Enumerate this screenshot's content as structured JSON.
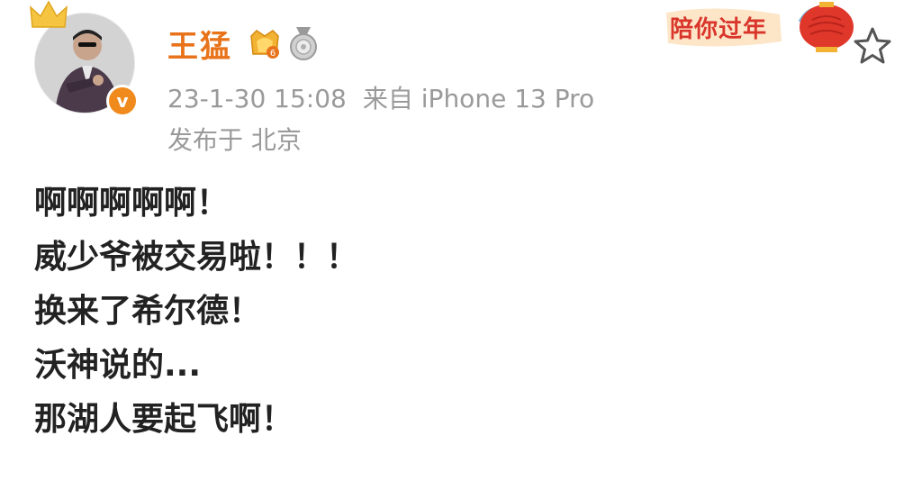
{
  "post": {
    "author": "王猛",
    "timestamp": "23-1-30 15:08",
    "source": "来自 iPhone 13 Pro",
    "location": "发布于 北京",
    "lines": [
      "啊啊啊啊啊！",
      "威少爷被交易啦！！！",
      "换来了希尔德！",
      "沃神说的...",
      "那湖人要起飞啊！"
    ]
  },
  "badges": {
    "verified_glyph": "v",
    "level_badge_icon": "gold-level-badge-icon",
    "medal_icon": "silver-medal-icon"
  },
  "decoration": {
    "newyear_label": "陪你过年"
  },
  "colors": {
    "username": "#e8731a",
    "meta": "#9a9a9a",
    "body_text": "#222222",
    "verified": "#f08a1d",
    "festive_red": "#d9352b"
  }
}
